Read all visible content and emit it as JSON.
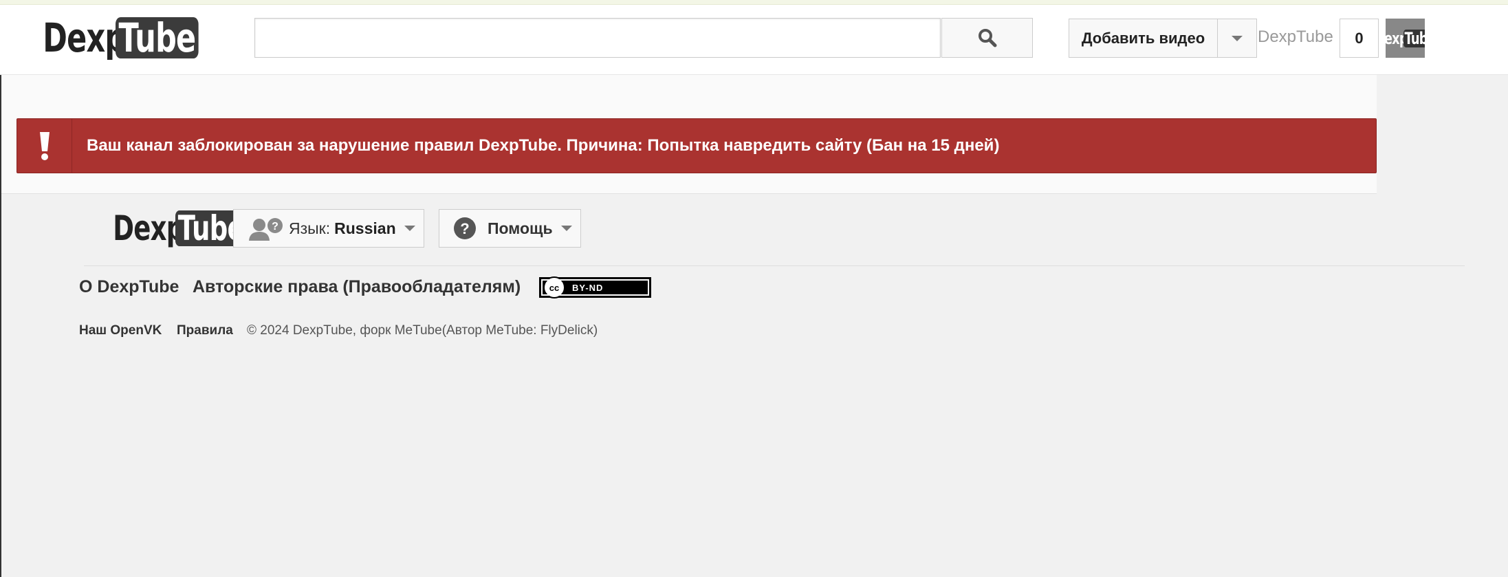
{
  "header": {
    "logo": {
      "dexp": "Dexp",
      "tube": "Tube"
    },
    "search": {
      "value": "",
      "placeholder": ""
    },
    "upload_label": "Добавить видео",
    "username": "DexpTube",
    "notification_count": "0"
  },
  "alert": {
    "message": "Ваш канал заблокирован за нарушение правил DexpTube. Причина: Попытка навредить сайту (Бан на 15 дней)",
    "color": "#aa3330"
  },
  "footer": {
    "logo": {
      "dexp": "Dexp",
      "tube": "Tube"
    },
    "language_label": "Язык:",
    "language_value": "Russian",
    "help_label": "Помощь",
    "links_main": [
      "О DexpTube",
      "Авторские права (Правообладателям)"
    ],
    "license_badge": {
      "cc": "cc",
      "label": "BY-ND"
    },
    "links_secondary": [
      "Наш OpenVK",
      "Правила"
    ],
    "copyright": "© 2024 DexpTube, форк MeTube(Автор MeTube: FlyDelick)"
  }
}
